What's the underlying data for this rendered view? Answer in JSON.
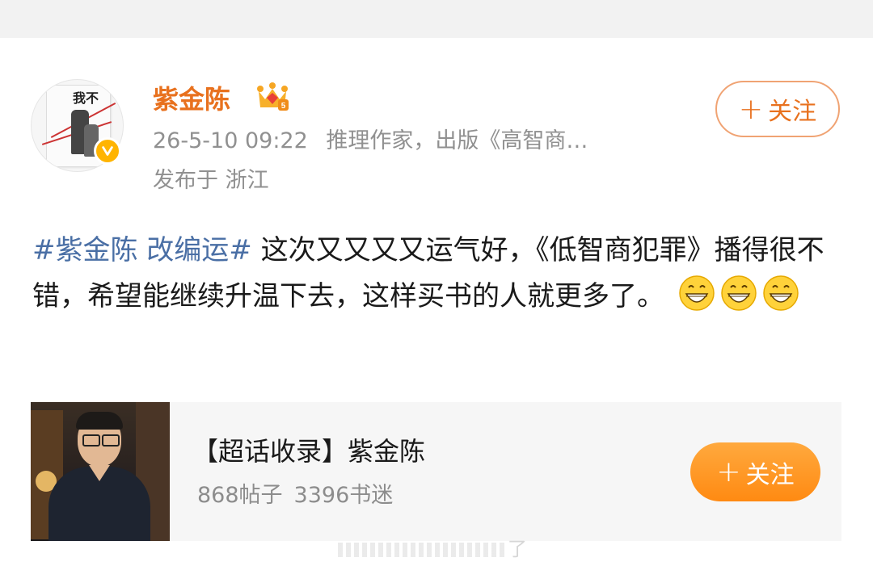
{
  "post": {
    "author": {
      "name": "紫金陈",
      "verified_icon": "verified-v-badge-icon",
      "crown_badge": "crown-badge-icon",
      "avatar_book_title": "我不服"
    },
    "timestamp": "26-5-10 09:22",
    "author_bio": "推理作家，出版《高智商…",
    "location": "发布于 浙江",
    "follow_label": "关注",
    "topic": "#紫金陈 改编运#",
    "text": " 这次又又又又运气好，《低智商犯罪》播得很不错，希望能继续升温下去，这样买书的人就更多了。",
    "emojis": [
      "grin-emoji",
      "grin-emoji",
      "grin-emoji"
    ]
  },
  "super_topic": {
    "title": "【超话收录】紫金陈",
    "posts": "868帖子",
    "fans": "3396书迷",
    "follow_label": "关注"
  },
  "watermark": "了",
  "colors": {
    "username": "#e8711e",
    "topic": "#4a6fa5",
    "follow_filled": "#ff9a25",
    "meta": "#909090"
  }
}
